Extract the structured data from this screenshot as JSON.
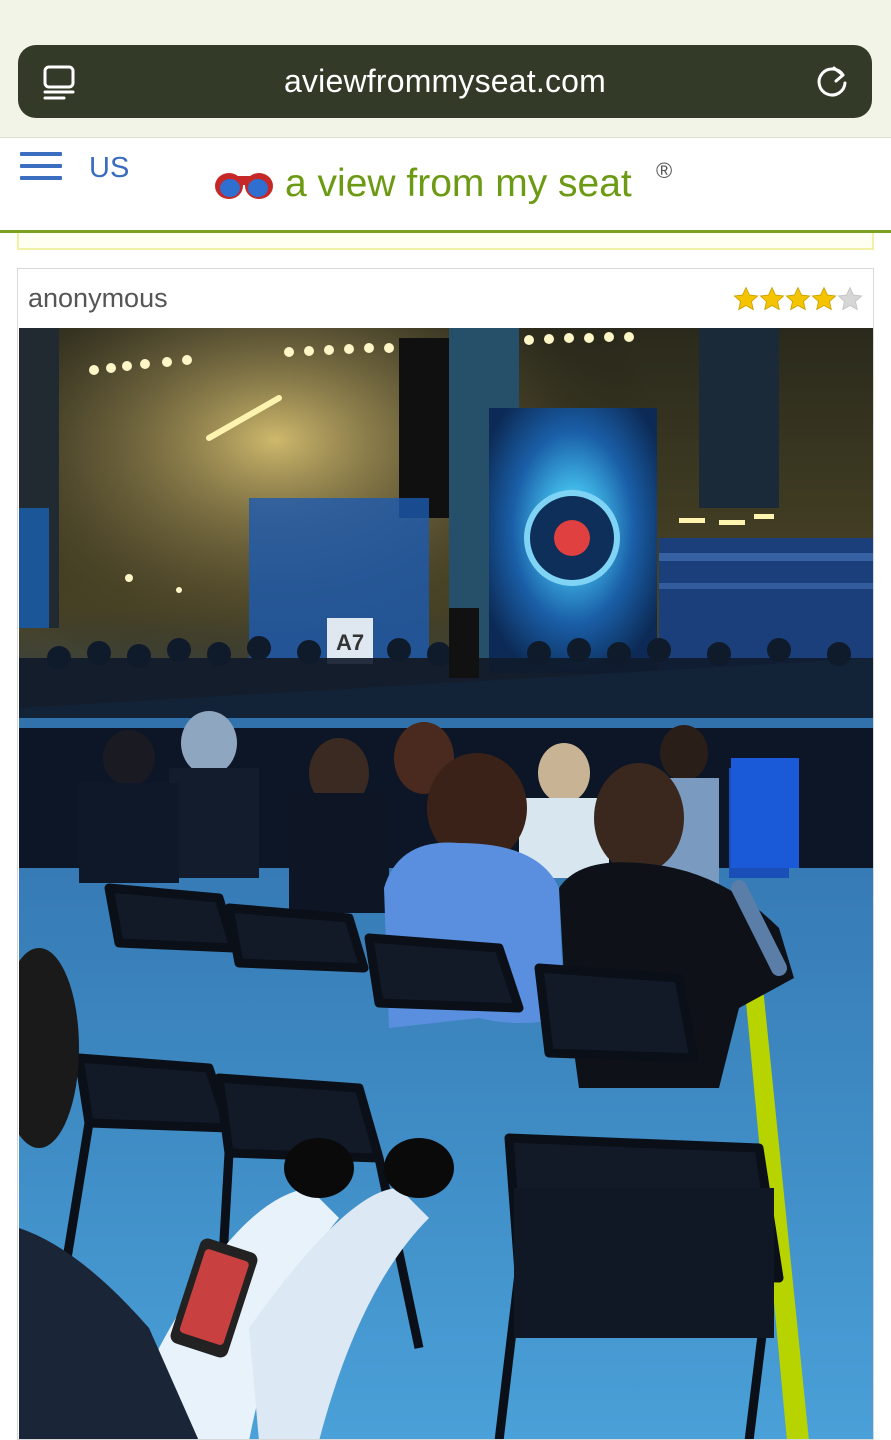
{
  "browser": {
    "url": "aviewfrommyseat.com"
  },
  "header": {
    "region": "US",
    "brand": "a view from my seat",
    "registered": "®"
  },
  "review": {
    "author": "anonymous",
    "rating": 4,
    "rating_max": 5,
    "section_sign": "A7"
  },
  "colors": {
    "brand_green": "#6d9a14",
    "link_blue": "#3a6cbf",
    "url_bar": "#333a28",
    "star_filled": "#f5c400",
    "star_empty": "#d6d6d6"
  },
  "icons": {
    "tabs": "tabs-icon",
    "reload": "reload-icon",
    "menu": "hamburger-icon",
    "logo": "binoculars-logo",
    "star": "star-icon"
  }
}
